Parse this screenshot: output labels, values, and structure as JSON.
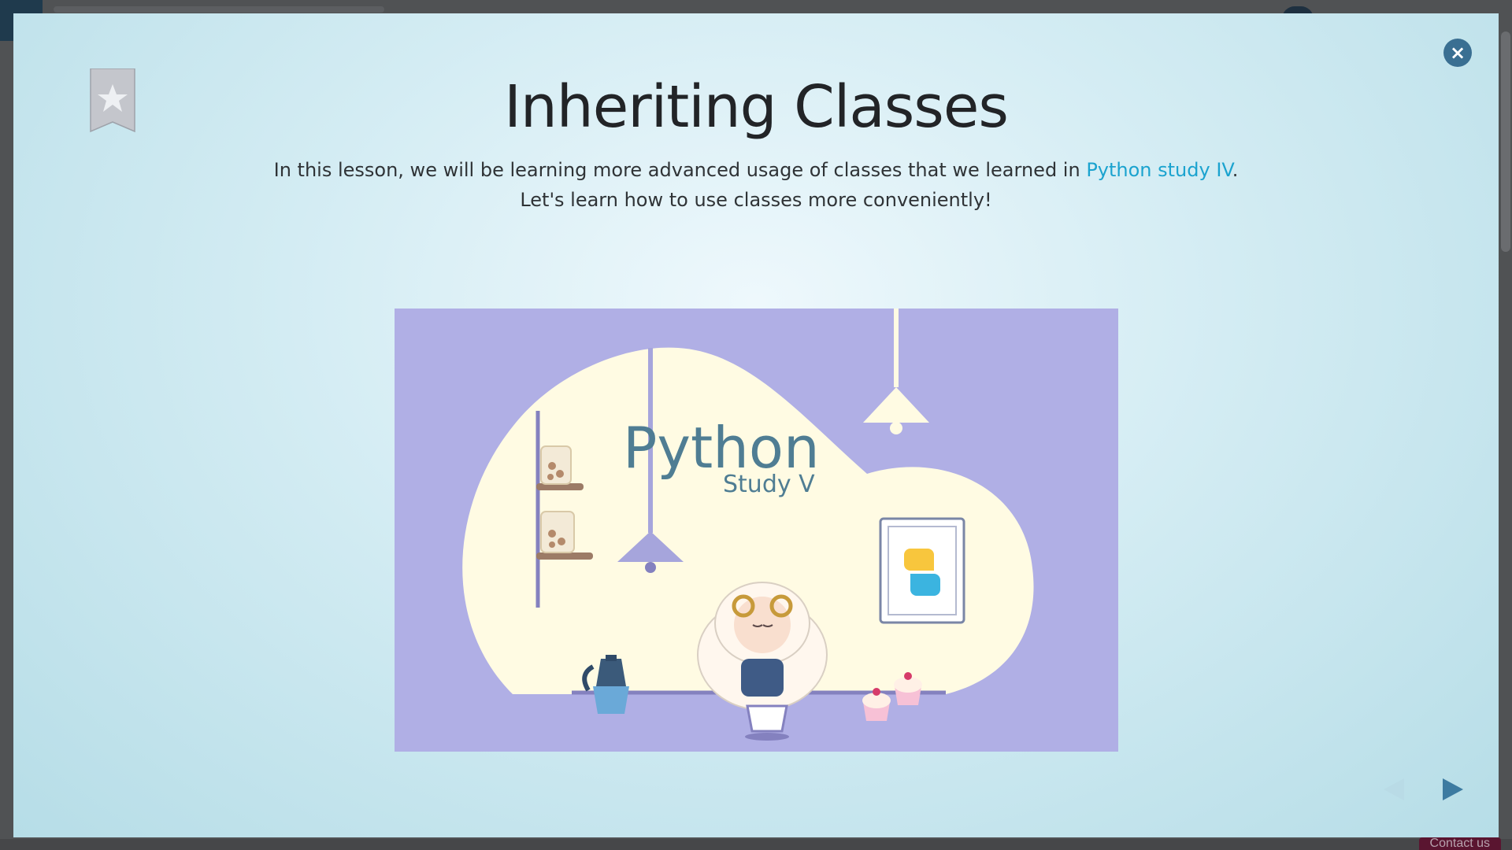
{
  "background": {
    "contact_label": "Contact us"
  },
  "modal": {
    "close_label": "×",
    "title": "Inheriting Classes",
    "description": {
      "line1_before": "In this lesson, we will be learning more advanced usage of classes that we learned in ",
      "link_text": "Python study IV",
      "line1_after": ".",
      "line2": "Let's learn how to use classes more conveniently!"
    },
    "cover": {
      "title": "Python",
      "subtitle": "Study V"
    }
  },
  "colors": {
    "accent_link": "#1ba3cf",
    "close_button": "#3a6f92",
    "cover_background": "#b0afe5",
    "cover_room": "#fffbe3"
  },
  "icons": {
    "close": "close-icon",
    "bookmark": "bookmark-star-icon",
    "prev": "prev-arrow-icon",
    "next": "next-arrow-icon"
  }
}
